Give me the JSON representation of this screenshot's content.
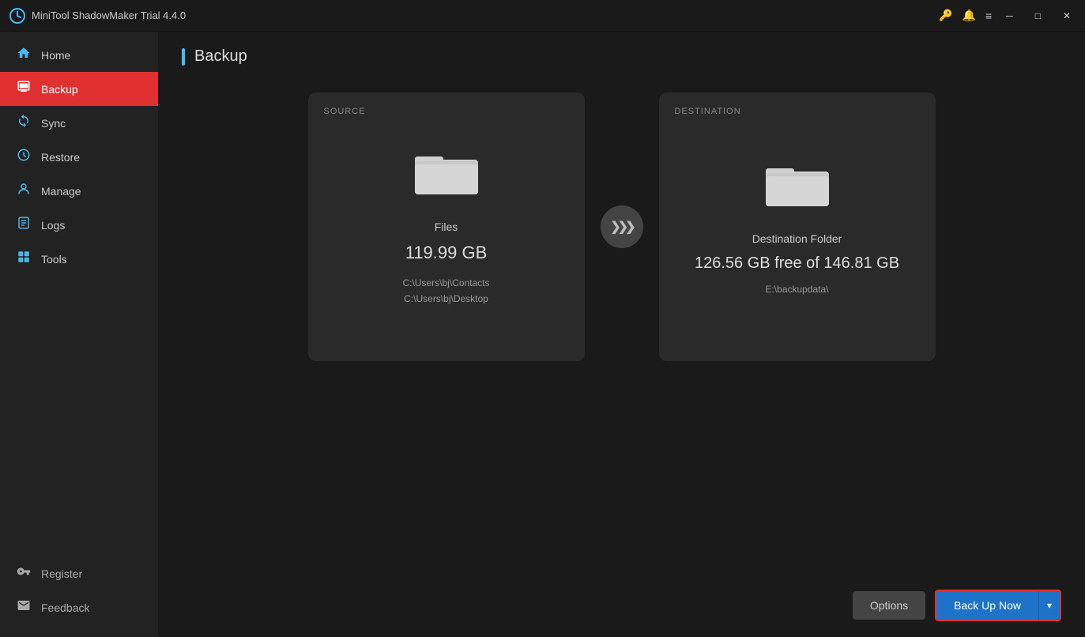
{
  "titlebar": {
    "title": "MiniTool ShadowMaker Trial 4.4.0",
    "icon": "🔄"
  },
  "sidebar": {
    "items": [
      {
        "id": "home",
        "label": "Home",
        "icon": "home"
      },
      {
        "id": "backup",
        "label": "Backup",
        "icon": "backup",
        "active": true
      },
      {
        "id": "sync",
        "label": "Sync",
        "icon": "sync"
      },
      {
        "id": "restore",
        "label": "Restore",
        "icon": "restore"
      },
      {
        "id": "manage",
        "label": "Manage",
        "icon": "manage"
      },
      {
        "id": "logs",
        "label": "Logs",
        "icon": "logs"
      },
      {
        "id": "tools",
        "label": "Tools",
        "icon": "tools"
      }
    ],
    "bottom_items": [
      {
        "id": "register",
        "label": "Register",
        "icon": "key"
      },
      {
        "id": "feedback",
        "label": "Feedback",
        "icon": "mail"
      }
    ]
  },
  "page": {
    "title": "Backup"
  },
  "source": {
    "label": "SOURCE",
    "icon": "folder",
    "name": "Files",
    "size": "119.99 GB",
    "paths": [
      "C:\\Users\\bj\\Contacts",
      "C:\\Users\\bj\\Desktop"
    ]
  },
  "destination": {
    "label": "DESTINATION",
    "icon": "folder",
    "name": "Destination Folder",
    "free": "126.56 GB free of 146.81 GB",
    "path": "E:\\backupdata\\"
  },
  "buttons": {
    "options": "Options",
    "backup_now": "Back Up Now",
    "dropdown_arrow": "▾"
  }
}
